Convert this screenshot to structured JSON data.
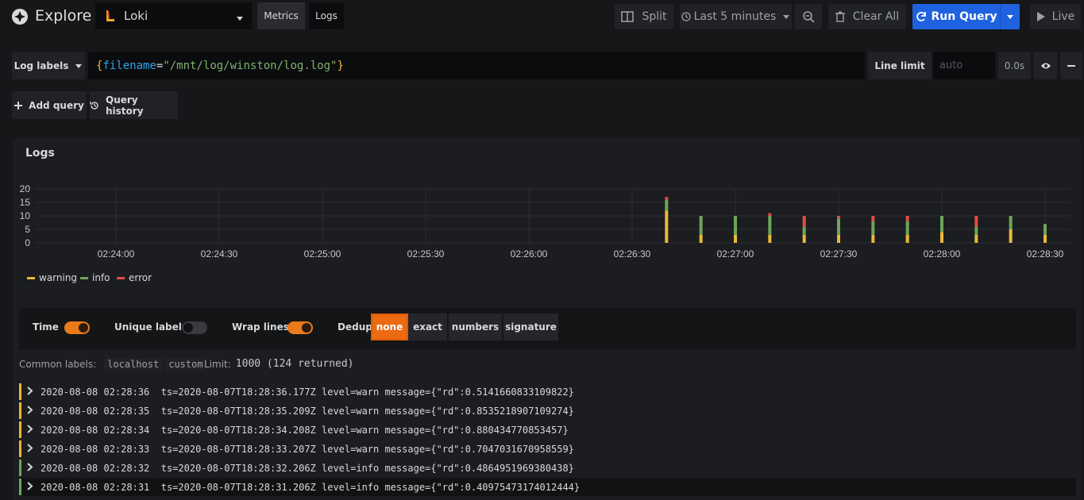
{
  "header": {
    "title": "Explore",
    "datasource": "Loki",
    "mode_tabs": [
      "Metrics",
      "Logs"
    ],
    "split_label": "Split",
    "time_range_label": "Last 5 minutes",
    "clear_label": "Clear All",
    "run_query_label": "Run Query",
    "live_label": "Live"
  },
  "query_row": {
    "labels_button": "Log labels",
    "query_open": "{",
    "query_key": "filename",
    "query_eq": "=",
    "query_value": "\"/mnt/log/winston/log.log\"",
    "query_close": "}",
    "line_limit_label": "Line limit",
    "line_limit_placeholder": "auto",
    "timing": "0.0s"
  },
  "actions": {
    "add_query": "Add query",
    "query_history": "Query history"
  },
  "panel": {
    "title": "Logs"
  },
  "chart_data": {
    "type": "bar",
    "stacked": true,
    "ylim": [
      0,
      20
    ],
    "y_ticks": [
      "0",
      "5",
      "10",
      "15",
      "20"
    ],
    "x_ticks": [
      "02:24:00",
      "02:24:30",
      "02:25:00",
      "02:25:30",
      "02:26:00",
      "02:26:30",
      "02:27:00",
      "02:27:30",
      "02:28:00",
      "02:28:30"
    ],
    "categories": [
      "02:26:40",
      "02:26:50",
      "02:27:00",
      "02:27:10",
      "02:27:20",
      "02:27:30",
      "02:27:40",
      "02:27:50",
      "02:28:00",
      "02:28:10",
      "02:28:20",
      "02:28:30"
    ],
    "series": [
      {
        "name": "warning",
        "color": "#eab839",
        "values": [
          12,
          3,
          3,
          3,
          3,
          3,
          3,
          3,
          4,
          3,
          5,
          3
        ]
      },
      {
        "name": "info",
        "color": "#6ea55a",
        "values": [
          4,
          7,
          7,
          7,
          3,
          6,
          5,
          5,
          6,
          3,
          5,
          4
        ]
      },
      {
        "name": "error",
        "color": "#e24d42",
        "values": [
          1,
          0,
          0,
          1,
          4,
          1,
          2,
          2,
          0,
          4,
          0,
          0
        ]
      }
    ],
    "legend_position": "bottom-left",
    "grid": true
  },
  "options": {
    "time_label": "Time",
    "unique_labels_label": "Unique labels",
    "wrap_lines_label": "Wrap lines",
    "dedup_label": "Dedup",
    "dedup_options": [
      "none",
      "exact",
      "numbers",
      "signature"
    ]
  },
  "meta": {
    "common_labels_label": "Common labels:",
    "common_labels": [
      "localhost",
      "custom"
    ],
    "limit_label": "Limit:",
    "limit_value": "1000 (124 returned)"
  },
  "logs": [
    {
      "level_color": "#eab839",
      "line": "2020-08-08 02:28:36  ts=2020-08-07T18:28:36.177Z level=warn message={\"rd\":0.5141660833109822}"
    },
    {
      "level_color": "#eab839",
      "line": "2020-08-08 02:28:35  ts=2020-08-07T18:28:35.209Z level=warn message={\"rd\":0.8535218907109274}"
    },
    {
      "level_color": "#eab839",
      "line": "2020-08-08 02:28:34  ts=2020-08-07T18:28:34.208Z level=warn message={\"rd\":0.880434770853457}"
    },
    {
      "level_color": "#eab839",
      "line": "2020-08-08 02:28:33  ts=2020-08-07T18:28:33.207Z level=warn message={\"rd\":0.7047031670958559}"
    },
    {
      "level_color": "#6ea55a",
      "line": "2020-08-08 02:28:32  ts=2020-08-07T18:28:32.206Z level=info message={\"rd\":0.4864951969380438}"
    },
    {
      "level_color": "#6ea55a",
      "line": "2020-08-08 02:28:31  ts=2020-08-07T18:28:31.206Z level=info message={\"rd\":0.40975473174012444}"
    }
  ]
}
